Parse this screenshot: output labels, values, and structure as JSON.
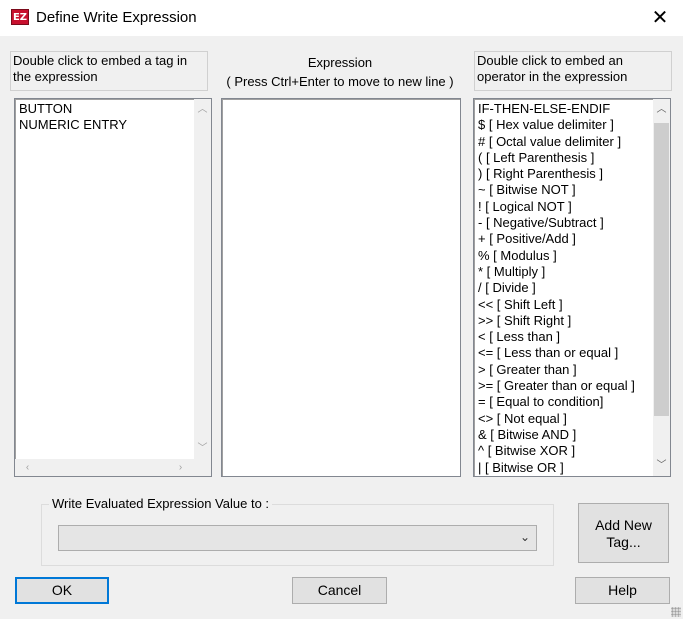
{
  "window": {
    "title": "Define Write Expression",
    "app_icon_text": "EZ",
    "close_glyph": "✕"
  },
  "tags_panel": {
    "header": "Double click to embed a tag in the expression",
    "items": [
      "BUTTON",
      "NUMERIC ENTRY"
    ]
  },
  "expression_panel": {
    "header_line1": "Expression",
    "header_line2": "( Press Ctrl+Enter to move to new line )",
    "value": ""
  },
  "operators_panel": {
    "header": "Double click to embed an operator in the expression",
    "items": [
      "IF-THEN-ELSE-ENDIF",
      "$ [ Hex value delimiter ]",
      "# [ Octal value delimiter ]",
      "( [ Left Parenthesis ]",
      ") [ Right Parenthesis ]",
      "~ [ Bitwise NOT ]",
      "! [ Logical NOT ]",
      "- [ Negative/Subtract ]",
      "+ [ Positive/Add ]",
      "% [ Modulus ]",
      "* [ Multiply ]",
      "/ [ Divide ]",
      "<< [ Shift Left ]",
      ">> [ Shift Right ]",
      "< [ Less than ]",
      "<= [ Less than or equal ]",
      "> [ Greater than ]",
      ">= [ Greater than or equal ]",
      "= [ Equal to condition]",
      "<> [ Not equal ]",
      "& [ Bitwise AND ]",
      "^ [ Bitwise XOR ]",
      "| [ Bitwise OR ]"
    ]
  },
  "write_to": {
    "label": "Write Evaluated Expression Value to :",
    "selected": ""
  },
  "buttons": {
    "add_new_tag_line1": "Add New",
    "add_new_tag_line2": "Tag...",
    "ok": "OK",
    "cancel": "Cancel",
    "help": "Help"
  },
  "colors": {
    "dialog_bg": "#f0f0f0",
    "default_button_border": "#0078d7",
    "app_icon": "#c8102e"
  }
}
